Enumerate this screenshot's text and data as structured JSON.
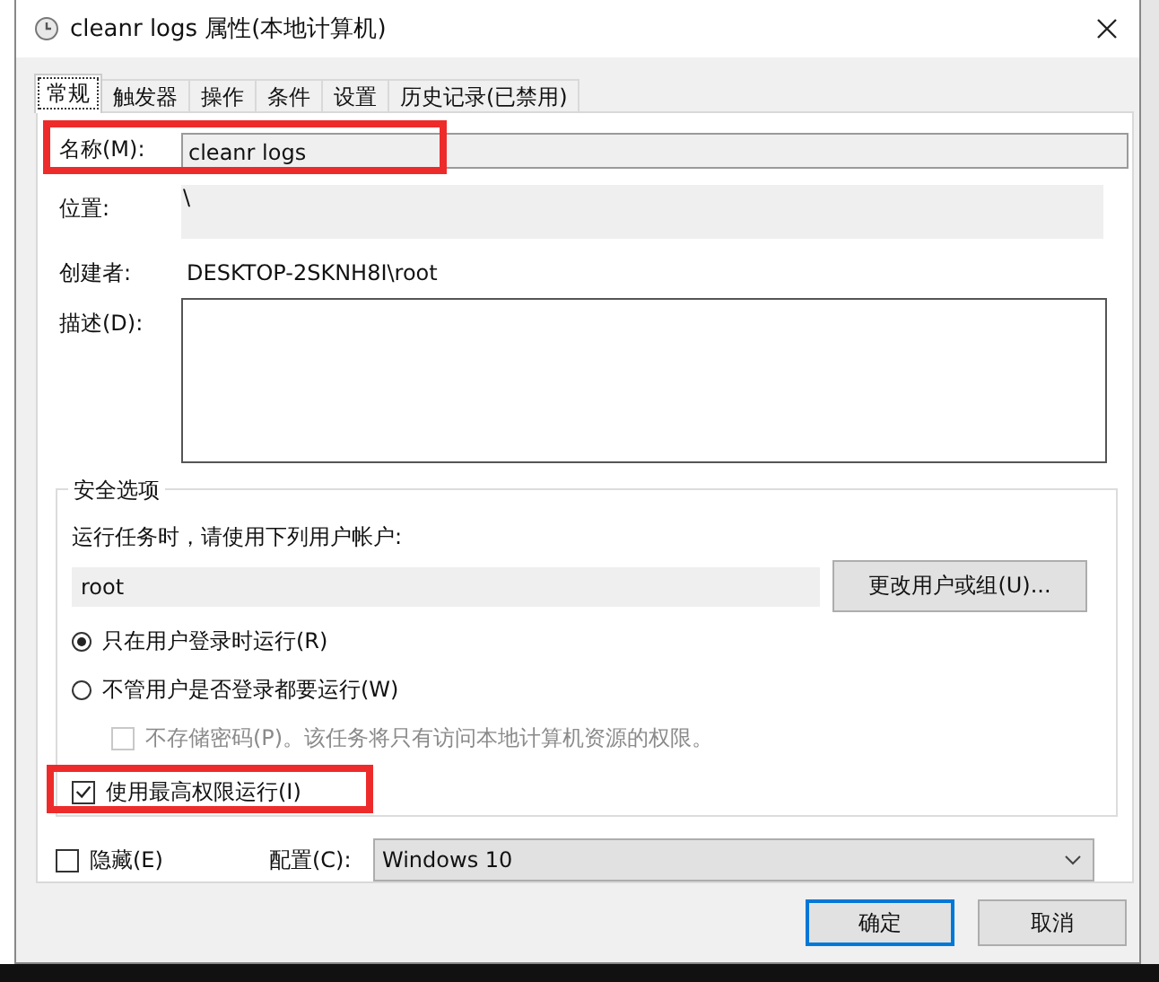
{
  "window": {
    "title": "cleanr logs 属性(本地计算机)"
  },
  "tabs": [
    {
      "label": "常规",
      "selected": true
    },
    {
      "label": "触发器",
      "selected": false
    },
    {
      "label": "操作",
      "selected": false
    },
    {
      "label": "条件",
      "selected": false
    },
    {
      "label": "设置",
      "selected": false
    },
    {
      "label": "历史记录(已禁用)",
      "selected": false
    }
  ],
  "fields": [
    {
      "kind": "input",
      "label": "名称(M):",
      "value": "cleanr logs",
      "highlighted": true
    },
    {
      "kind": "readonly",
      "label": "位置:",
      "value": "\\",
      "highlighted": false
    },
    {
      "kind": "text",
      "label": "创建者:",
      "value": "DESKTOP-2SKNH8I\\root",
      "highlighted": false
    },
    {
      "kind": "textarea",
      "label": "描述(D):",
      "highlighted": false
    }
  ],
  "security": {
    "title": "安全选项",
    "prompt": "运行任务时，请使用下列用户帐户:",
    "account": "root",
    "change_button": "更改用户或组(U)...",
    "options": [
      {
        "label": "只在用户登录时运行(R)",
        "selected": true
      },
      {
        "label": "不管用户是否登录都要运行(W)",
        "selected": false,
        "children": [
          {
            "label": "不存储密码(P)。该任务将只有访问本地计算机资源的权限。",
            "checked": false,
            "disabled": true
          }
        ]
      }
    ],
    "highest_privileges": {
      "label": "使用最高权限运行(I)",
      "checked": true,
      "highlighted": true
    }
  },
  "hidden": {
    "label": "隐藏(E)",
    "checked": false
  },
  "config": {
    "label": "配置(C):",
    "value": "Windows 10"
  },
  "buttons": [
    {
      "label": "确定",
      "default": true
    },
    {
      "label": "取消",
      "default": false
    }
  ]
}
